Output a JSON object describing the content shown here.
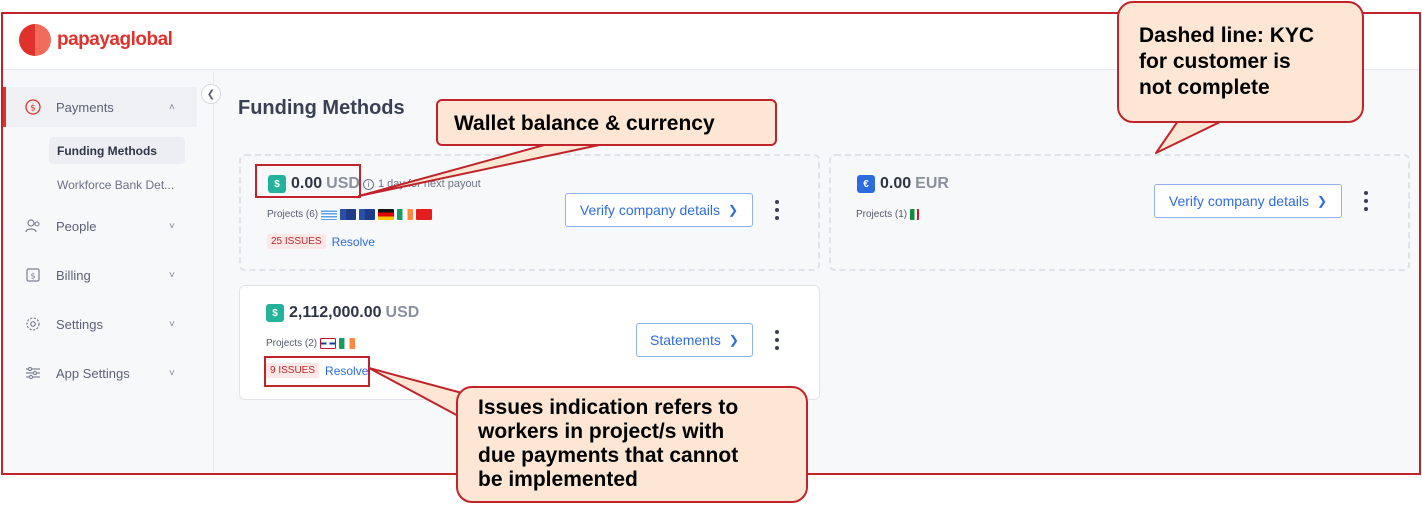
{
  "brand": {
    "name": "papayaglobal"
  },
  "sidebar": {
    "payments": {
      "label": "Payments",
      "icon": "dollar-circle-icon"
    },
    "subitems": [
      "Funding Methods",
      "Workforce Bank Det..."
    ],
    "people": {
      "label": "People",
      "icon": "people-icon"
    },
    "billing": {
      "label": "Billing",
      "icon": "billing-icon"
    },
    "settings": {
      "label": "Settings",
      "icon": "gear-icon"
    },
    "app_settings": {
      "label": "App Settings",
      "icon": "sliders-icon"
    }
  },
  "main": {
    "title": "Funding Methods",
    "cards": [
      {
        "currency_symbol": "$",
        "amount": "0.00",
        "code": "USD",
        "payout": "1 day for next payout",
        "projects": "Projects (6)",
        "flags": [
          "UY",
          "AU",
          "AU",
          "DE",
          "IE",
          "AL"
        ],
        "issues": "25 ISSUES",
        "resolve": "Resolve",
        "button": "Verify company details",
        "kyc_complete": false
      },
      {
        "currency_symbol": "€",
        "amount": "0.00",
        "code": "EUR",
        "projects": "Projects (1)",
        "flags": [
          "DZ"
        ],
        "button": "Verify company details",
        "kyc_complete": false
      },
      {
        "currency_symbol": "$",
        "amount": "2,112,000.00",
        "code": "USD",
        "projects": "Projects (2)",
        "flags": [
          "GB",
          "IE"
        ],
        "issues": "9 ISSUES",
        "resolve": "Resolve",
        "button": "Statements",
        "kyc_complete": true
      }
    ]
  },
  "annotations": {
    "wallet": "Wallet balance & currency",
    "kyc": [
      "Dashed line: KYC",
      "for customer is",
      "not complete"
    ],
    "issues": [
      "Issues indication refers to",
      "workers in project/s with",
      "due payments that cannot",
      "be implemented"
    ]
  },
  "colors": {
    "accent": "#e0322d",
    "link": "#2d6cdf",
    "callout_bg": "#fde6d4",
    "callout_border": "#c0242a"
  }
}
